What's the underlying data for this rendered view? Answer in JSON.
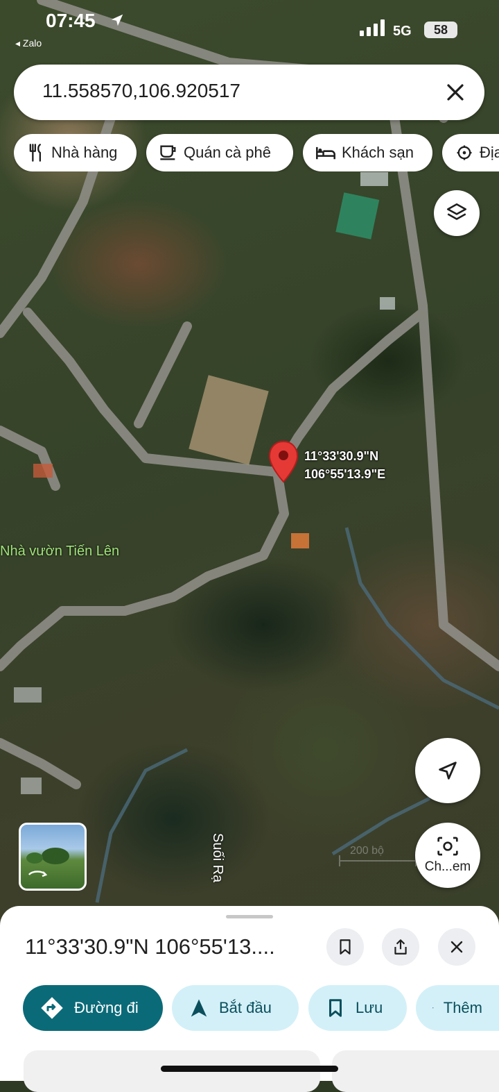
{
  "status": {
    "time": "07:45",
    "back_app": "◂ Zalo",
    "network": "5G",
    "battery": "58"
  },
  "search": {
    "value": "11.558570,106.920517"
  },
  "chips": [
    {
      "label": "Nhà hàng",
      "icon": "restaurant-icon"
    },
    {
      "label": "Quán cà phê",
      "icon": "coffee-icon"
    },
    {
      "label": "Khách sạn",
      "icon": "hotel-icon"
    },
    {
      "label": "Địa",
      "icon": "attraction-icon"
    }
  ],
  "map": {
    "pin_lat": "11°33'30.9\"N",
    "pin_lon": "106°55'13.9\"E",
    "place_label": "Nhà vườn Tiến Lên",
    "stream_label": "Suối Rạ",
    "scale_label": "200 bộ",
    "lens_label": "Ch...em"
  },
  "sheet": {
    "title": "11°33'30.9\"N 106°55'13....",
    "actions": [
      {
        "label": "Đường đi",
        "icon": "directions-icon"
      },
      {
        "label": "Bắt đầu",
        "icon": "navigation-icon"
      },
      {
        "label": "Lưu",
        "icon": "bookmark-icon"
      },
      {
        "label": "Thêm",
        "icon": "flag-icon"
      }
    ]
  },
  "colors": {
    "primary": "#0b6a78",
    "secondary": "#d3f0f8",
    "pin": "#e53935"
  }
}
